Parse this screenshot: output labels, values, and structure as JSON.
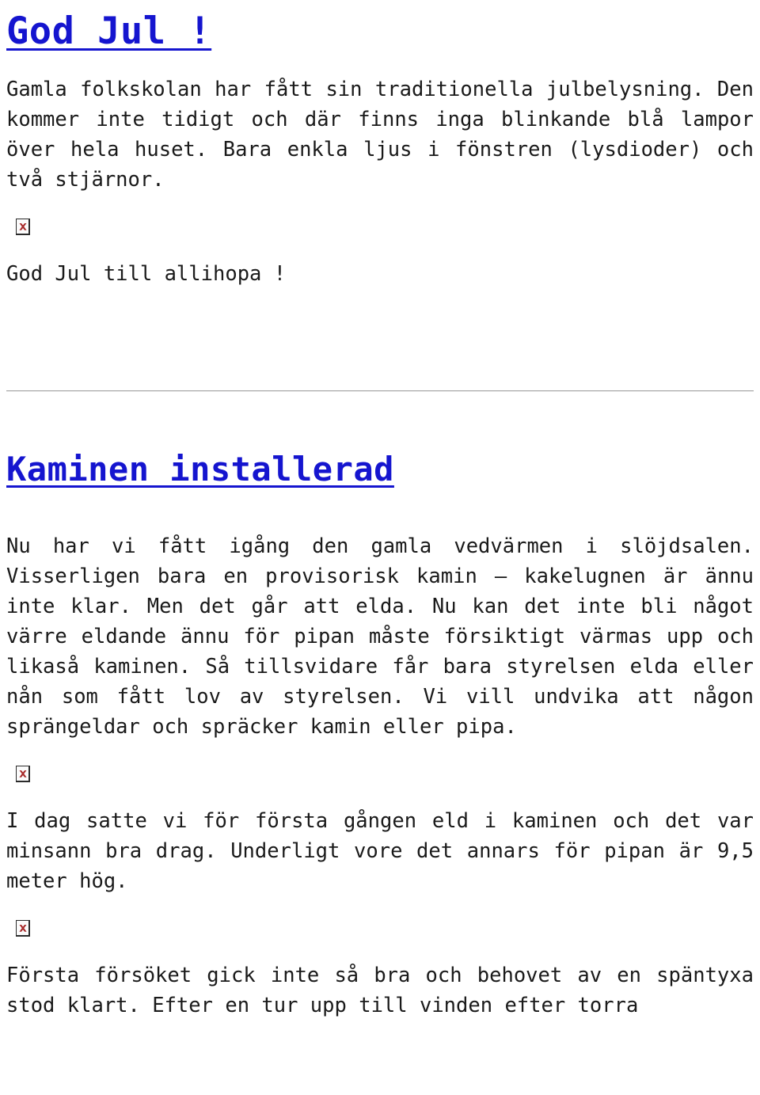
{
  "document": {
    "language": "sv",
    "text_color": "#1a1a1a",
    "heading_color": "#1515cf",
    "background_color": "#ffffff",
    "divider_color": "#a8a8a8"
  },
  "posts": [
    {
      "title": "God Jul !",
      "paragraphs": [
        "Gamla folkskolan har fått sin traditionella julbelysning. Den kommer inte tidigt och där finns inga blinkande blå lampor över hela huset. Bara enkla ljus i fönstren (lysdioder) och två stjärnor.",
        "God Jul till allihopa !"
      ],
      "images": [
        {
          "alt": "",
          "state": "broken",
          "icon": "broken-image-icon"
        }
      ]
    },
    {
      "title": "Kaminen installerad",
      "paragraphs": [
        "Nu har vi fått igång den gamla vedvärmen i slöjdsalen. Visserligen bara en provisorisk kamin – kakelugnen är ännu inte klar. Men det går att elda. Nu kan det inte bli något värre eldande ännu för pipan måste försiktigt värmas upp och likaså kaminen. Så tillsvidare får bara styrelsen elda eller nån som fått lov av styrelsen. Vi vill undvika att någon sprängeldar och spräcker kamin eller pipa.",
        "I dag satte vi för första gången eld i kaminen och det var minsann bra drag. Underligt vore det annars för pipan är 9,5 meter hög.",
        "Första försöket gick inte så bra och behovet av en späntyxa stod klart. Efter en tur upp till vinden efter torra"
      ],
      "images": [
        {
          "alt": "",
          "state": "broken",
          "icon": "broken-image-icon"
        },
        {
          "alt": "",
          "state": "broken",
          "icon": "broken-image-icon"
        }
      ]
    }
  ]
}
